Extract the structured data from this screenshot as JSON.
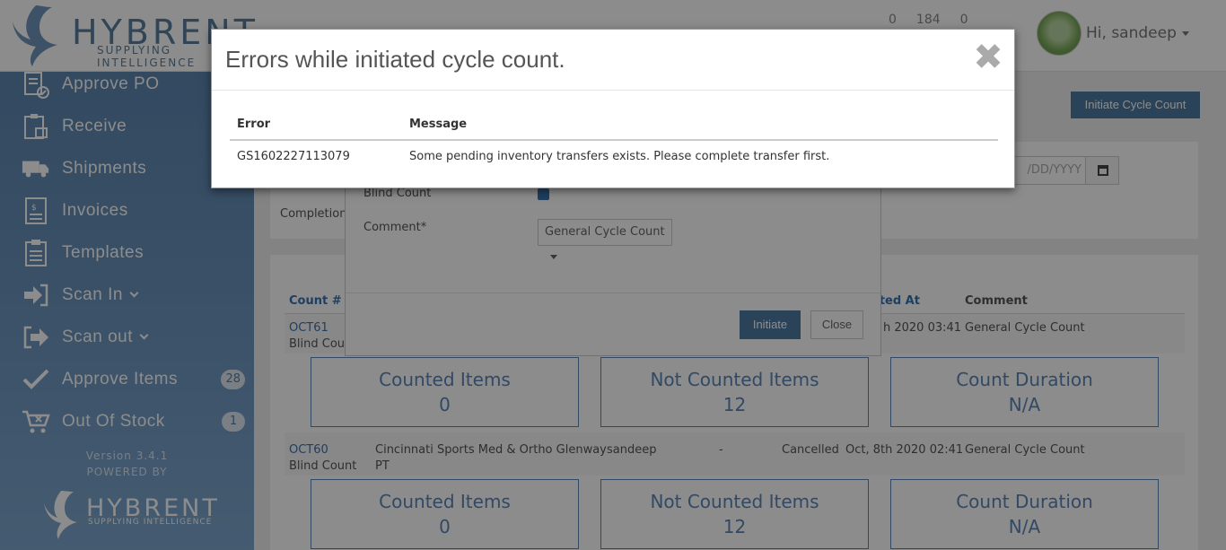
{
  "header": {
    "brand": "HYBRENT",
    "tagline": "SUPPLYING INTELLIGENCE",
    "counters": [
      "0",
      "184",
      "0"
    ],
    "greeting": "Hi, sandeep"
  },
  "sidebar": {
    "items": [
      {
        "label": "Approve PO",
        "icon": "approve-po-icon"
      },
      {
        "label": "Receive",
        "icon": "receive-icon"
      },
      {
        "label": "Shipments",
        "icon": "truck-icon"
      },
      {
        "label": "Invoices",
        "icon": "invoice-icon"
      },
      {
        "label": "Templates",
        "icon": "clipboard-icon"
      },
      {
        "label": "Scan In",
        "icon": "sign-in-icon"
      },
      {
        "label": "Scan out",
        "icon": "sign-out-icon"
      },
      {
        "label": "Approve Items",
        "icon": "check-icon",
        "badge": "28"
      },
      {
        "label": "Out Of Stock",
        "icon": "cart-icon",
        "badge": "1"
      }
    ],
    "version": "Version 3.4.1",
    "powered_by": "POWERED BY",
    "footer_brand": "HYBRENT",
    "footer_tagline": "SUPPLYING INTELLIGENCE"
  },
  "main": {
    "initiate_button": "Initiate Cycle Count",
    "date_placeholder": "/DD/YYYY",
    "completion_label": "Completion",
    "table": {
      "col_count": "Count #",
      "col_completed": "eted At",
      "col_comment": "Comment"
    },
    "rows": [
      {
        "count": "OCT61",
        "type": "Blind Cou",
        "completed": "h 2020 03:41",
        "comment": "General Cycle Count",
        "stats": {
          "counted_label": "Counted Items",
          "counted": "0",
          "not_counted_label": "Not Counted Items",
          "not_counted": "12",
          "duration_label": "Count Duration",
          "duration": "N/A"
        }
      },
      {
        "count": "OCT60",
        "type": "Blind Count",
        "facility": "Cincinnati Sports Med & Ortho Glenway",
        "facility2": "PT",
        "user": "sandeep",
        "dash": "-",
        "status": "Cancelled",
        "completed": "Oct, 8th 2020 02:41",
        "comment": "General Cycle Count",
        "stats": {
          "counted_label": "Counted Items",
          "counted": "0",
          "not_counted_label": "Not Counted Items",
          "not_counted": "12",
          "duration_label": "Count Duration",
          "duration": "N/A"
        }
      }
    ]
  },
  "initiate_modal": {
    "blind_count_label": "Blind Count",
    "comment_label": "Comment*",
    "comment_value": "General Cycle Count",
    "initiate_button": "Initiate",
    "close_button": "Close"
  },
  "error_modal": {
    "title": "Errors while initiated cycle count.",
    "close_glyph": "✖",
    "col_error": "Error",
    "col_message": "Message",
    "rows": [
      {
        "error": "GS1602227113079",
        "message": "Some pending inventory transfers exists. Please complete transfer first."
      }
    ]
  }
}
